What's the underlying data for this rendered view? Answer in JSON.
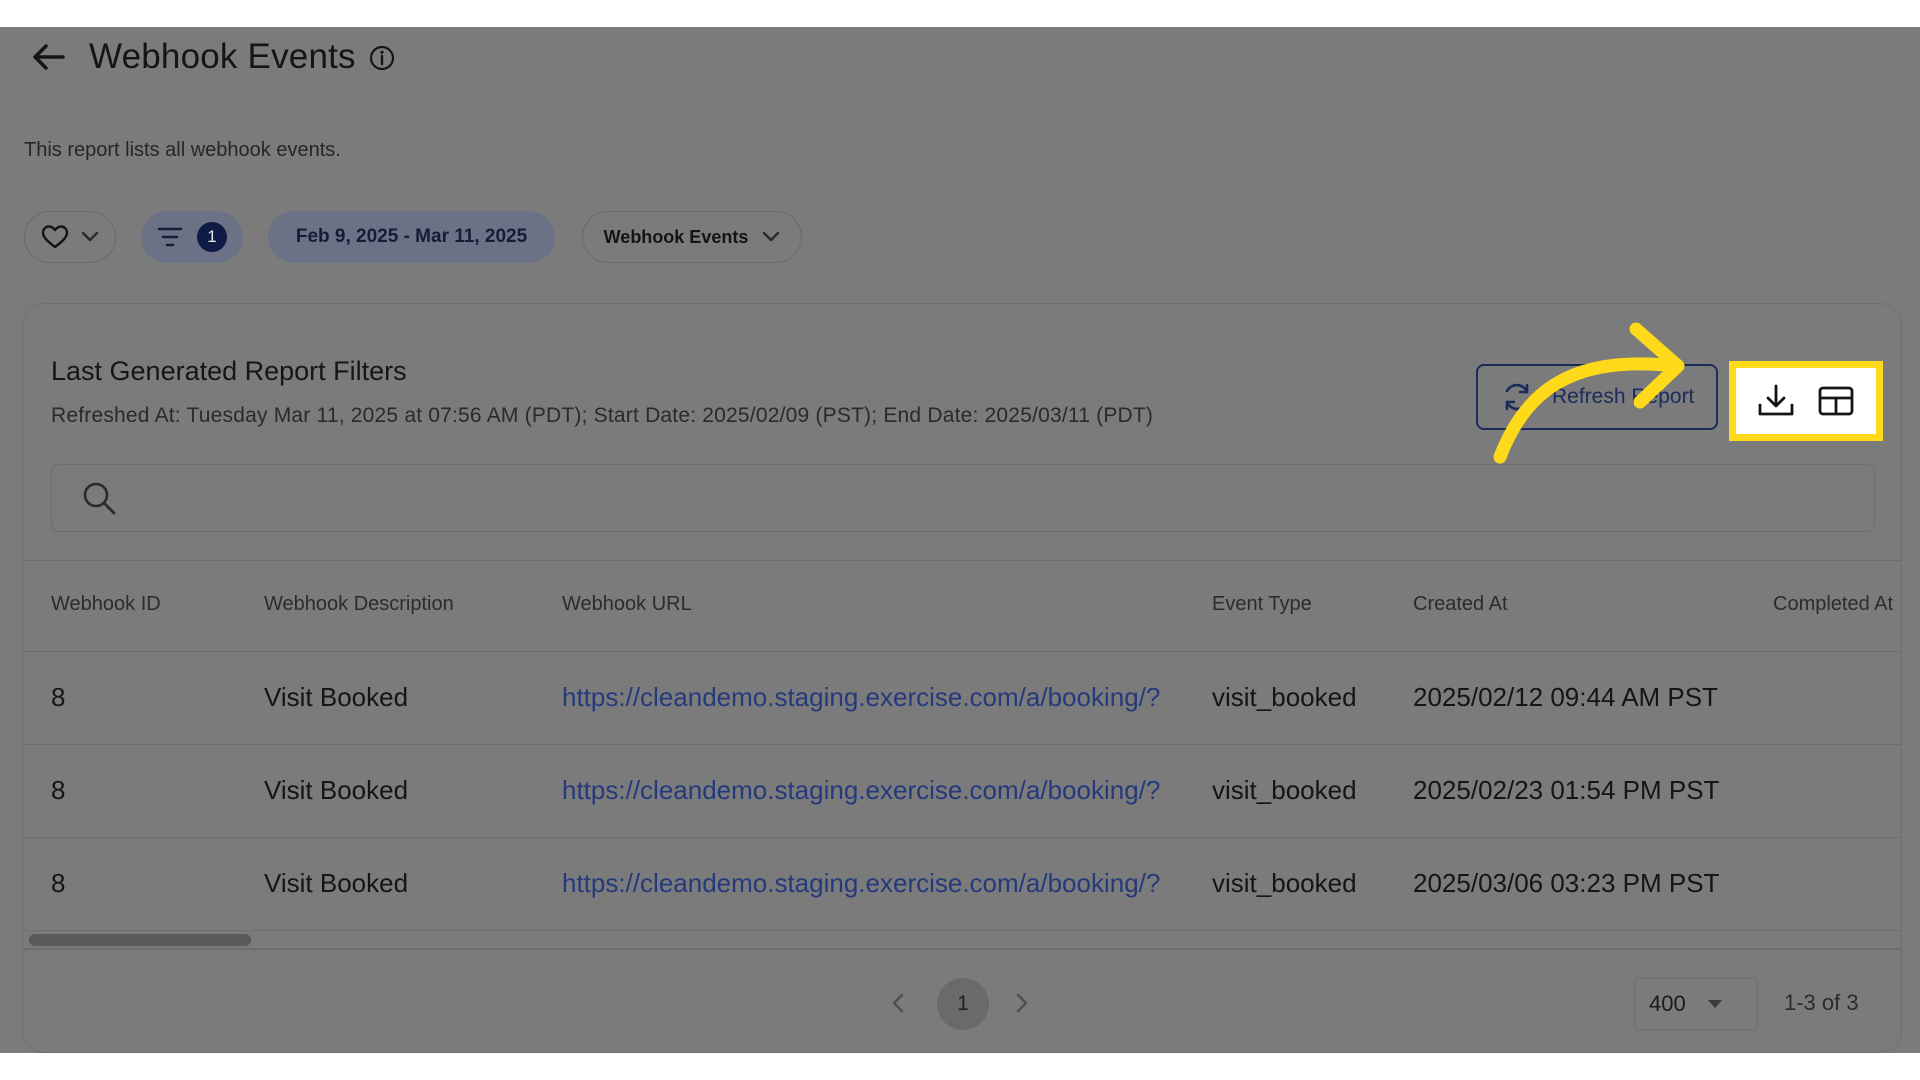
{
  "header": {
    "title": "Webhook Events",
    "subtitle": "This report lists all webhook events."
  },
  "filters": {
    "active_filter_count": "1",
    "date_range": "Feb 9, 2025 - Mar 11, 2025",
    "report_select": "Webhook Events"
  },
  "card": {
    "title": "Last Generated Report Filters",
    "meta": "Refreshed At: Tuesday Mar 11, 2025 at 07:56 AM (PDT); Start Date: 2025/02/09 (PST); End Date: 2025/03/11 (PDT)",
    "refresh_label": "Refresh Report"
  },
  "search": {
    "placeholder": ""
  },
  "table": {
    "columns": [
      "Webhook ID",
      "Webhook Description",
      "Webhook URL",
      "Event Type",
      "Created At",
      "Completed At"
    ],
    "rows": [
      {
        "id": "8",
        "description": "Visit Booked",
        "url": "https://cleandemo.staging.exercise.com/a/booking/?",
        "event_type": "visit_booked",
        "created_at": "2025/02/12 09:44 AM PST"
      },
      {
        "id": "8",
        "description": "Visit Booked",
        "url": "https://cleandemo.staging.exercise.com/a/booking/?",
        "event_type": "visit_booked",
        "created_at": "2025/02/23 01:54 PM PST"
      },
      {
        "id": "8",
        "description": "Visit Booked",
        "url": "https://cleandemo.staging.exercise.com/a/booking/?",
        "event_type": "visit_booked",
        "created_at": "2025/03/06 03:23 PM PST"
      }
    ]
  },
  "pagination": {
    "current_page": "1",
    "page_size": "400",
    "range": "1-3 of 3"
  },
  "colors": {
    "overlay_gray": "#7b7b7b",
    "highlight_yellow": "#ffda1a",
    "link_blue": "#243a7c",
    "navy": "#1b2c5a"
  },
  "icons": [
    "back-arrow-icon",
    "info-icon",
    "heart-icon",
    "chevron-down-icon",
    "filter-icon",
    "refresh-icon",
    "download-icon",
    "table-columns-icon",
    "search-icon",
    "chevron-left-icon",
    "chevron-right-icon",
    "caret-down-icon"
  ]
}
